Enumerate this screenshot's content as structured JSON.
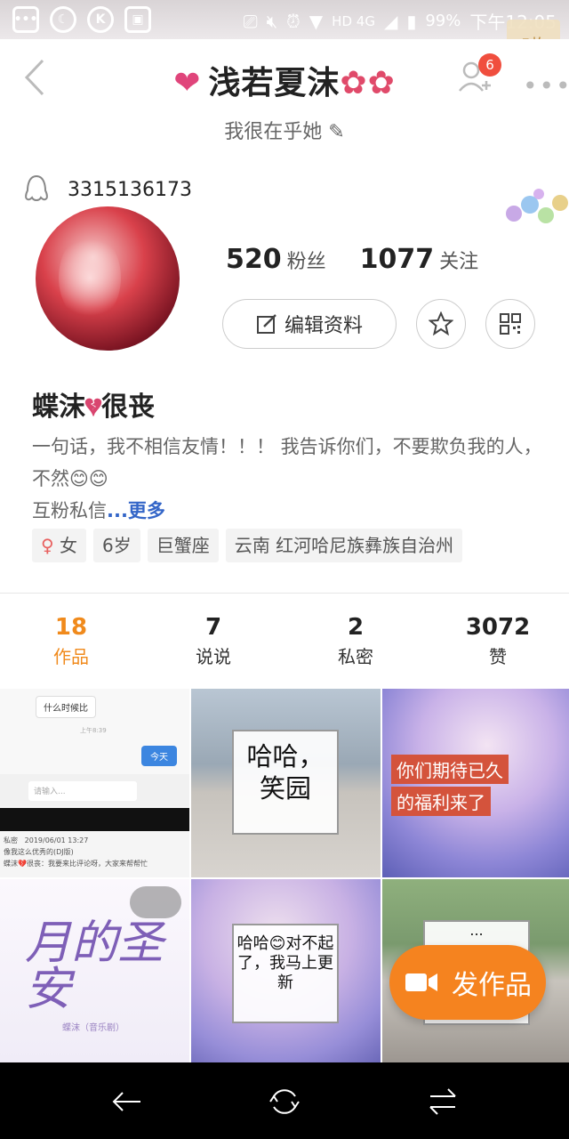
{
  "status_bar": {
    "network": "HD 4G",
    "battery": "99%",
    "time": "下午12:05",
    "corner_badge": "5枚"
  },
  "header": {
    "title": "浅若夏沫",
    "remark": "我很在乎她",
    "notification_count": "6"
  },
  "profile": {
    "qq_number": "3315136173",
    "followers_count": "520",
    "followers_label": "粉丝",
    "following_count": "1077",
    "following_label": "关注",
    "edit_button": "编辑资料",
    "nickname_part1": "蝶沫",
    "nickname_part2": "很丧",
    "bio_line": "一句话，我不相信友情！！！ 我告诉你们，不要欺负我的人，不然😊😊",
    "bio_line2": "互粉私信",
    "more_link": "...更多",
    "tags": {
      "gender": "女",
      "age": "6岁",
      "zodiac": "巨蟹座",
      "location": "云南 红河哈尼族彝族自治州"
    }
  },
  "tabs": [
    {
      "count": "18",
      "label": "作品"
    },
    {
      "count": "7",
      "label": "说说"
    },
    {
      "count": "2",
      "label": "私密"
    },
    {
      "count": "3072",
      "label": "赞"
    }
  ],
  "works": {
    "chat_question": "什么时候比",
    "chat_time": "上午8:39",
    "chat_reply": "今天",
    "chat_input_placeholder": "请输入...",
    "notif_header": "私密",
    "notif_date": "2019/06/01 13:27",
    "notif_line1": "像我这么优秀的(DJ版)",
    "notif_line2": "蝶沫💔很丧：我要来比评论呀，大家来帮帮忙",
    "card2_line1": "哈哈，",
    "card2_line2": "笑园",
    "card3_line1": "你们期待已久",
    "card3_line2": "的福利来了",
    "card4_title": "月的圣安",
    "card4_sub": "蝶沫（音乐剧）",
    "card5_text": "哈哈😊对不起了，我马上更新",
    "card6_text": "..."
  },
  "fab_label": "发作品"
}
